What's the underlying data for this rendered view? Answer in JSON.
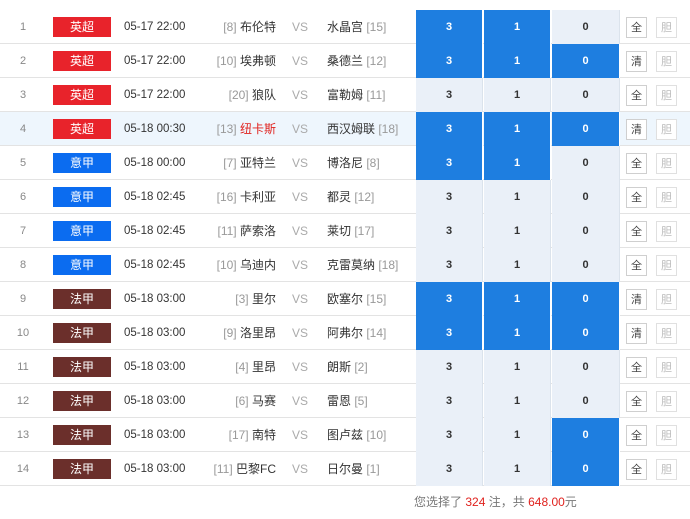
{
  "leagues": {
    "yingchao": {
      "label": "英超",
      "color": "#e8232b"
    },
    "yijia": {
      "label": "意甲",
      "color": "#0b6cf0"
    },
    "fajia": {
      "label": "法甲",
      "color": "#6b2f2b"
    }
  },
  "vs_label": "VS",
  "matches": [
    {
      "no": "1",
      "league": "英超",
      "time": "05-17 22:00",
      "home_rank": "[8]",
      "home": "布伦特",
      "away": "水晶宫",
      "away_rank": "[15]",
      "odds": [
        "3",
        "1",
        "0"
      ],
      "sel": [
        true,
        true,
        false
      ],
      "btn1": "全",
      "btn2": "胆"
    },
    {
      "no": "2",
      "league": "英超",
      "time": "05-17 22:00",
      "home_rank": "[10]",
      "home": "埃弗顿",
      "away": "桑德兰",
      "away_rank": "[12]",
      "odds": [
        "3",
        "1",
        "0"
      ],
      "sel": [
        true,
        true,
        true
      ],
      "btn1": "清",
      "btn2": "胆"
    },
    {
      "no": "3",
      "league": "英超",
      "time": "05-17 22:00",
      "home_rank": "[20]",
      "home": "狼队",
      "away": "富勒姆",
      "away_rank": "[11]",
      "odds": [
        "3",
        "1",
        "0"
      ],
      "sel": [
        false,
        false,
        false
      ],
      "btn1": "全",
      "btn2": "胆"
    },
    {
      "no": "4",
      "league": "英超",
      "time": "05-18 00:30",
      "home_rank": "[13]",
      "home": "纽卡斯",
      "away": "西汉姆联",
      "away_rank": "[18]",
      "odds": [
        "3",
        "1",
        "0"
      ],
      "sel": [
        true,
        true,
        true
      ],
      "btn1": "清",
      "btn2": "胆"
    },
    {
      "no": "5",
      "league": "意甲",
      "time": "05-18 00:00",
      "home_rank": "[7]",
      "home": "亚特兰",
      "away": "博洛尼",
      "away_rank": "[8]",
      "odds": [
        "3",
        "1",
        "0"
      ],
      "sel": [
        true,
        true,
        false
      ],
      "btn1": "全",
      "btn2": "胆"
    },
    {
      "no": "6",
      "league": "意甲",
      "time": "05-18 02:45",
      "home_rank": "[16]",
      "home": "卡利亚",
      "away": "都灵",
      "away_rank": "[12]",
      "odds": [
        "3",
        "1",
        "0"
      ],
      "sel": [
        false,
        false,
        false
      ],
      "btn1": "全",
      "btn2": "胆"
    },
    {
      "no": "7",
      "league": "意甲",
      "time": "05-18 02:45",
      "home_rank": "[11]",
      "home": "萨索洛",
      "away": "莱切",
      "away_rank": "[17]",
      "odds": [
        "3",
        "1",
        "0"
      ],
      "sel": [
        false,
        false,
        false
      ],
      "btn1": "全",
      "btn2": "胆"
    },
    {
      "no": "8",
      "league": "意甲",
      "time": "05-18 02:45",
      "home_rank": "[10]",
      "home": "乌迪内",
      "away": "克雷莫纳",
      "away_rank": "[18]",
      "odds": [
        "3",
        "1",
        "0"
      ],
      "sel": [
        false,
        false,
        false
      ],
      "btn1": "全",
      "btn2": "胆"
    },
    {
      "no": "9",
      "league": "法甲",
      "time": "05-18 03:00",
      "home_rank": "[3]",
      "home": "里尔",
      "away": "欧塞尔",
      "away_rank": "[15]",
      "odds": [
        "3",
        "1",
        "0"
      ],
      "sel": [
        true,
        true,
        true
      ],
      "btn1": "清",
      "btn2": "胆"
    },
    {
      "no": "10",
      "league": "法甲",
      "time": "05-18 03:00",
      "home_rank": "[9]",
      "home": "洛里昂",
      "away": "阿弗尔",
      "away_rank": "[14]",
      "odds": [
        "3",
        "1",
        "0"
      ],
      "sel": [
        true,
        true,
        true
      ],
      "btn1": "清",
      "btn2": "胆"
    },
    {
      "no": "11",
      "league": "法甲",
      "time": "05-18 03:00",
      "home_rank": "[4]",
      "home": "里昂",
      "away": "朗斯",
      "away_rank": "[2]",
      "odds": [
        "3",
        "1",
        "0"
      ],
      "sel": [
        false,
        false,
        false
      ],
      "btn1": "全",
      "btn2": "胆"
    },
    {
      "no": "12",
      "league": "法甲",
      "time": "05-18 03:00",
      "home_rank": "[6]",
      "home": "马赛",
      "away": "雷恩",
      "away_rank": "[5]",
      "odds": [
        "3",
        "1",
        "0"
      ],
      "sel": [
        false,
        false,
        false
      ],
      "btn1": "全",
      "btn2": "胆"
    },
    {
      "no": "13",
      "league": "法甲",
      "time": "05-18 03:00",
      "home_rank": "[17]",
      "home": "南特",
      "away": "图卢兹",
      "away_rank": "[10]",
      "odds": [
        "3",
        "1",
        "0"
      ],
      "sel": [
        false,
        false,
        true
      ],
      "btn1": "全",
      "btn2": "胆"
    },
    {
      "no": "14",
      "league": "法甲",
      "time": "05-18 03:00",
      "home_rank": "[11]",
      "home": "巴黎FC",
      "away": "日尔曼",
      "away_rank": "[1]",
      "odds": [
        "3",
        "1",
        "0"
      ],
      "sel": [
        false,
        false,
        true
      ],
      "btn1": "全",
      "btn2": "胆"
    }
  ],
  "highlight_row": "4",
  "red_home_row": "4",
  "footer": {
    "prefix": "您选择了",
    "count": "324",
    "mid": "注，共",
    "amount": "648.00",
    "suffix": "元"
  }
}
